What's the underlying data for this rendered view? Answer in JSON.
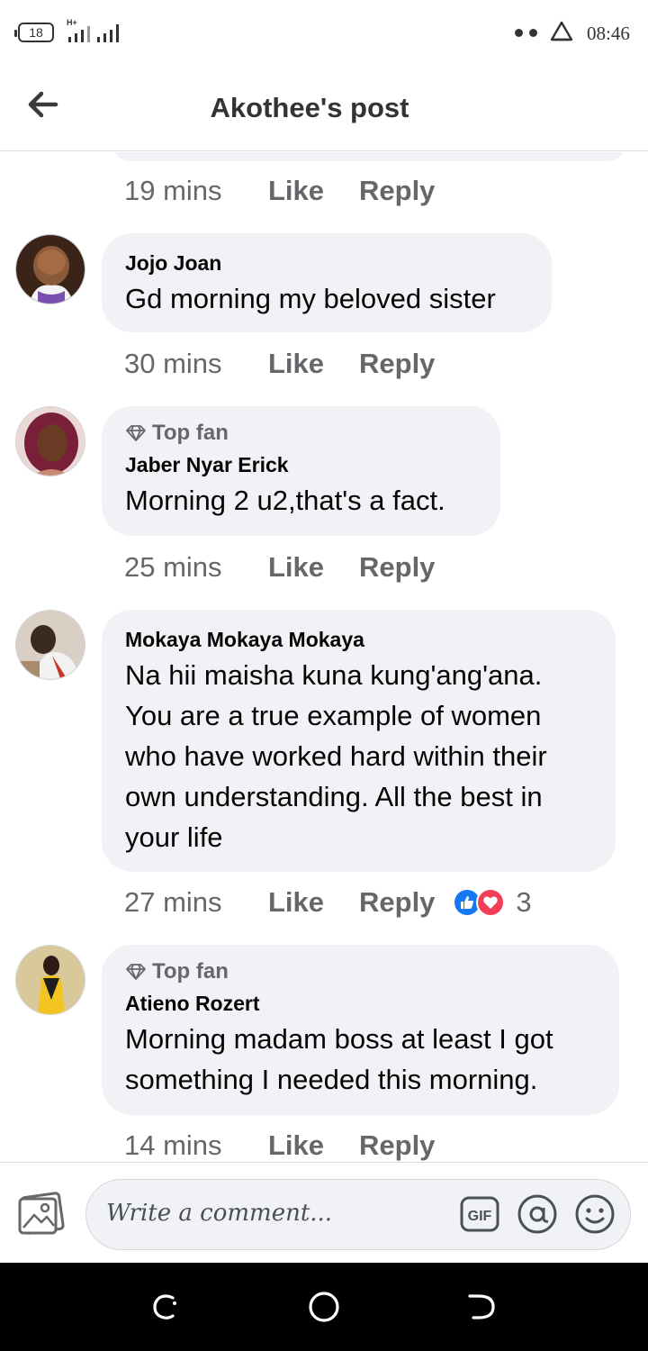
{
  "status_bar": {
    "battery": "18",
    "network": "H+",
    "time": "08:46",
    "icons": [
      "battery-icon",
      "signal-icon",
      "signal-icon",
      "dots-icon",
      "alert-triangle-icon"
    ]
  },
  "header": {
    "title": "Akothee's post",
    "back_icon": "back-arrow-icon"
  },
  "comments": [
    {
      "time": "19 mins",
      "like_label": "Like",
      "reply_label": "Reply"
    },
    {
      "author": "Jojo Joan",
      "text": "Gd morning my beloved sister",
      "badge": "",
      "time": "30 mins",
      "like_label": "Like",
      "reply_label": "Reply"
    },
    {
      "author": "Jaber Nyar Erick",
      "text": "Morning 2 u2,that's a fact.",
      "badge": "Top fan",
      "time": "25 mins",
      "like_label": "Like",
      "reply_label": "Reply"
    },
    {
      "author": "Mokaya Mokaya Mokaya",
      "text_lines": [
        "Na hii maisha kuna kung'ang'ana.",
        "You are a true example of women",
        "who have worked hard within their",
        "own understanding.  All the best in",
        "your life"
      ],
      "badge": "",
      "time": "27 mins",
      "like_label": "Like",
      "reply_label": "Reply",
      "reactions": {
        "types": [
          "like",
          "love"
        ],
        "count": "3"
      }
    },
    {
      "author": "Atieno Rozert",
      "text_lines": [
        "Morning madam boss at least I got",
        "something I needed this morning."
      ],
      "badge": "Top fan",
      "time": "14 mins",
      "like_label": "Like",
      "reply_label": "Reply"
    }
  ],
  "composer": {
    "placeholder": "Write a comment...",
    "icons": [
      "photo-icon",
      "gif-icon",
      "mention-icon",
      "emoji-icon"
    ]
  },
  "nav_bar": {
    "icons": [
      "recent-apps-icon",
      "home-icon",
      "back-icon"
    ]
  },
  "colors": {
    "bubble": "#f0f2f5",
    "meta_text": "#65676b",
    "like_blue": "#1877f2",
    "love_red": "#f33e58"
  }
}
